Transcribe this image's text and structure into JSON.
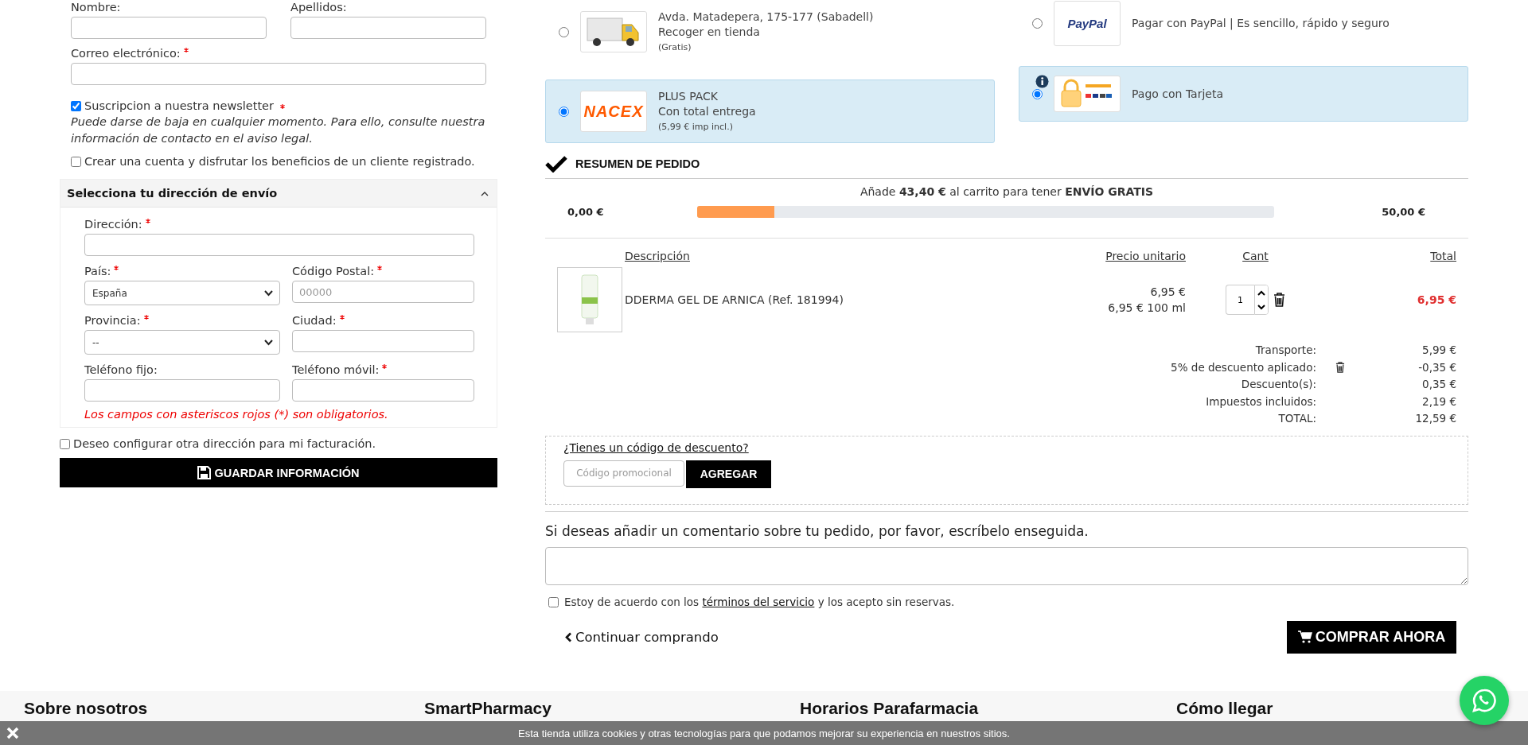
{
  "contact_form": {
    "fields": [
      {
        "label": "Nombre:",
        "required": false
      },
      {
        "label": "Apellidos:",
        "required": false
      },
      {
        "label": "Correo electrónico:",
        "required": true
      }
    ],
    "newsletter": {
      "label": "Suscripcion a nuestra newsletter",
      "required": true,
      "checked": true
    },
    "newsletter_note": "Puede darse de baja en cualquier momento. Para ello, consulte nuestra información de contacto en el aviso legal.",
    "create_account": {
      "label": "Crear una cuenta y disfrutar los beneficios de un cliente registrado.",
      "checked": false
    }
  },
  "shipping_address": {
    "title": "Selecciona tu dirección de envío",
    "expanded": true,
    "fields": [
      {
        "label": "Dirección:",
        "required": true,
        "kind": "wide"
      },
      {
        "label": "País:",
        "required": true,
        "kind": "select",
        "value": "España"
      },
      {
        "label": "Código Postal:",
        "required": true,
        "kind": "text",
        "placeholder": "00000"
      },
      {
        "label": "Provincia:",
        "required": true,
        "kind": "select",
        "value": "--"
      },
      {
        "label": "Ciudad:",
        "required": true,
        "kind": "text"
      },
      {
        "label": "Teléfono fijo:",
        "required": false,
        "kind": "text"
      },
      {
        "label": "Teléfono móvil:",
        "required": true,
        "kind": "text"
      }
    ],
    "required_note": "Los campos con asteriscos rojos (*) son obligatorios."
  },
  "billing_option": {
    "label": "Deseo configurar otra dirección para mi facturación.",
    "checked": false
  },
  "save_button": "GUARDAR INFORMACIÓN",
  "carriers": [
    {
      "kind": "truck",
      "lines": [
        "Avda. Matadepera, 175-177 (Sabadell)",
        "Recoger en tienda"
      ],
      "note": "(Gratis)",
      "selected": false
    },
    {
      "kind": "nacex",
      "logo": "NACEX",
      "lines": [
        "PLUS PACK",
        "Con total entrega"
      ],
      "note": "(5,99 € imp incl.)",
      "selected": true
    }
  ],
  "payments": [
    {
      "kind": "paypal",
      "logo": "PayPal",
      "label": "Pagar con PayPal | Es sencillo, rápido y seguro",
      "selected": false
    },
    {
      "kind": "card",
      "label": "Pago con Tarjeta",
      "selected": true
    }
  ],
  "summary": {
    "title": "RESUMEN DE PEDIDO",
    "free_shipping_message": "Añade **43,40 €** al carrito para tener **ENVÍO GRATIS**",
    "min": "0,00 €",
    "max": "50,00 €",
    "level": 0.134
  },
  "cart": {
    "columns": [
      "Descripción",
      "Precio unitario",
      "Cant",
      "Total"
    ],
    "items": [
      {
        "name": "DDERMA GEL DE ARNICA (Ref. 181994)",
        "unit_price": "6,95 €",
        "unit_price_per": "6,95 € 100 ml",
        "quantity": "1",
        "total": "6,95 €"
      }
    ]
  },
  "totals": [
    {
      "label": "Transporte:",
      "value": "5,99 €",
      "removable": false
    },
    {
      "label": "5% de descuento aplicado:",
      "value": "-0,35 €",
      "removable": true
    },
    {
      "label": "Descuento(s):",
      "value": "0,35 €",
      "removable": false
    },
    {
      "label": "Impuestos incluidos:",
      "value": "2,19 €",
      "removable": false
    },
    {
      "label": "TOTAL:",
      "value": "12,59 €",
      "removable": false
    }
  ],
  "discount": {
    "link": "¿Tienes un código de descuento?",
    "placeholder": "Código promocional",
    "button": "AGREGAR"
  },
  "comment": {
    "label": "Si deseas añadir un comentario sobre tu pedido, por favor, escríbelo enseguida."
  },
  "terms": {
    "before": "Estoy de acuerdo con los",
    "link": "términos del servicio",
    "after": "y los acepto sin reservas.",
    "checked": false
  },
  "continue_link": "Continuar comprando",
  "buy_button": "COMPRAR AHORA",
  "footer": {
    "headings": [
      "Sobre nosotros",
      "SmartPharmacy",
      "Horarios Parafarmacia",
      "Cómo llegar"
    ]
  },
  "cookie_bar": {
    "text": "Esta tienda utiliza cookies y otras tecnologías para que podamos mejorar su experiencia en nuestros sitios."
  }
}
